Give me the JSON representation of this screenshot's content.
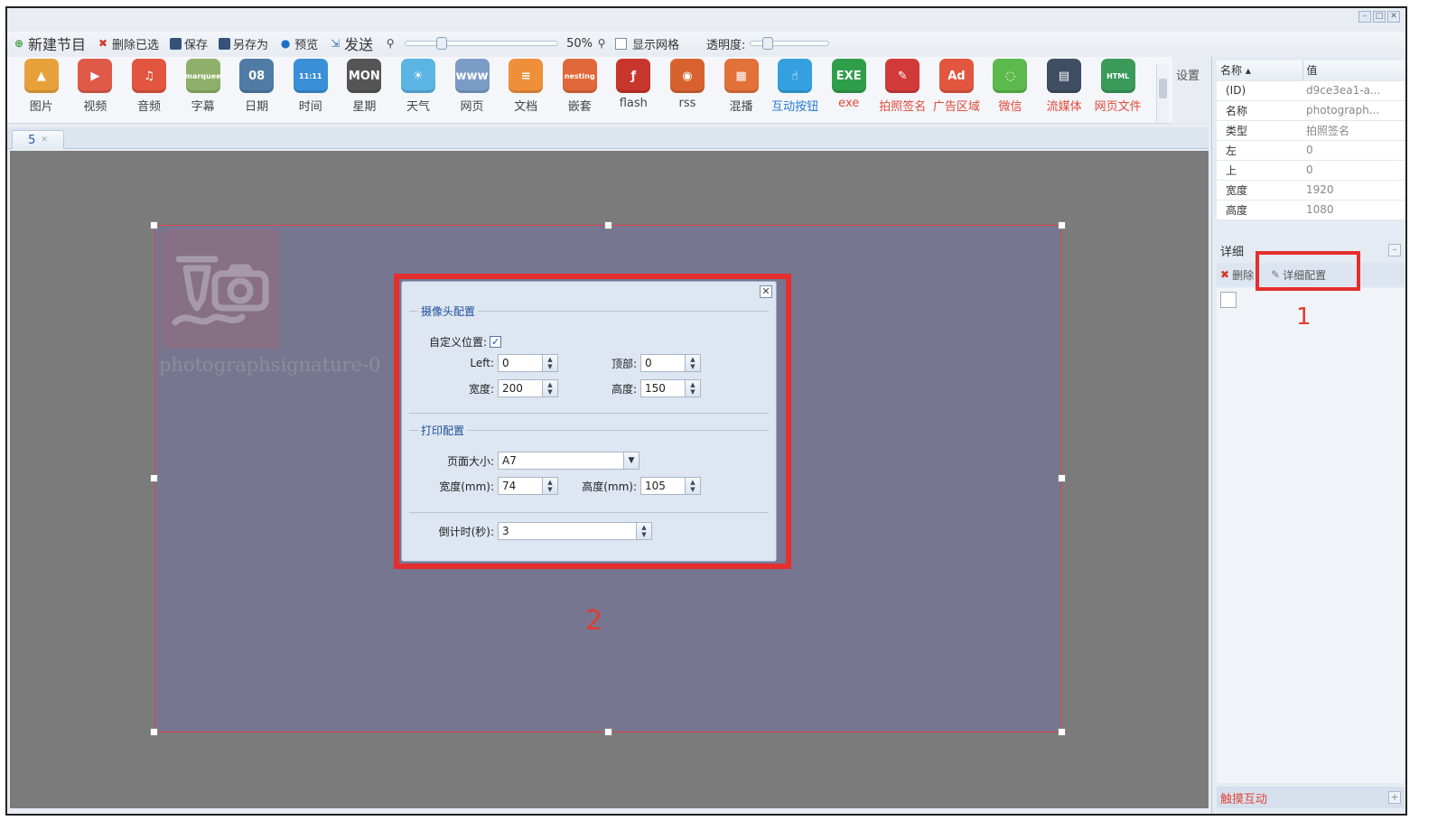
{
  "window_buttons": [
    "–",
    "□",
    "✕"
  ],
  "toolbar": {
    "new_program": "新建节目",
    "delete_selected": "删除已选",
    "save": "保存",
    "save_as": "另存为",
    "preview": "预览",
    "send": "发送",
    "zoom_label": "50%",
    "zoom_level": 0.2,
    "show_grid": "显示网格",
    "opacity_label": "透明度:",
    "opacity_level": 0.15
  },
  "ribbon": {
    "items": [
      {
        "label": "图片",
        "icon": "image-icon",
        "color": "#e8a13a",
        "glyph": "▲"
      },
      {
        "label": "视频",
        "icon": "video-icon",
        "color": "#e05a4a",
        "glyph": "▶"
      },
      {
        "label": "音频",
        "icon": "audio-icon",
        "color": "#e2563f",
        "glyph": "♫"
      },
      {
        "label": "字幕",
        "icon": "marquee-icon",
        "color": "#8fb06a",
        "glyph": "marquee"
      },
      {
        "label": "日期",
        "icon": "date-icon",
        "color": "#4f7ba6",
        "glyph": "08"
      },
      {
        "label": "时间",
        "icon": "time-icon",
        "color": "#3a8fd6",
        "glyph": "11:11"
      },
      {
        "label": "星期",
        "icon": "weekday-icon",
        "color": "#555555",
        "glyph": "MON"
      },
      {
        "label": "天气",
        "icon": "weather-icon",
        "color": "#5ab4e4",
        "glyph": "☀"
      },
      {
        "label": "网页",
        "icon": "webpage-icon",
        "color": "#7a9cc6",
        "glyph": "www"
      },
      {
        "label": "文档",
        "icon": "document-icon",
        "color": "#f08f3a",
        "glyph": "≡"
      },
      {
        "label": "嵌套",
        "icon": "nesting-icon",
        "color": "#e0683a",
        "glyph": "nesting"
      },
      {
        "label": "flash",
        "icon": "flash-icon",
        "color": "#c8352c",
        "glyph": "ƒ"
      },
      {
        "label": "rss",
        "icon": "rss-icon",
        "color": "#d8622f",
        "glyph": "◉"
      },
      {
        "label": "混播",
        "icon": "mixed-play-icon",
        "color": "#e2713a",
        "glyph": "▦"
      },
      {
        "label": "互动按钮",
        "icon": "interactive-button-icon",
        "color": "#35a0e0",
        "glyph": "☝",
        "style": "blue"
      },
      {
        "label": "exe",
        "icon": "exe-icon",
        "color": "#2e9e4a",
        "glyph": "EXE",
        "style": "red"
      },
      {
        "label": "拍照签名",
        "icon": "photo-signature-icon",
        "color": "#d23a3a",
        "glyph": "✎",
        "style": "red"
      },
      {
        "label": "广告区域",
        "icon": "ad-area-icon",
        "color": "#e2563f",
        "glyph": "Ad",
        "style": "red"
      },
      {
        "label": "微信",
        "icon": "wechat-icon",
        "color": "#5cb94b",
        "glyph": "◌",
        "style": "red"
      },
      {
        "label": "流媒体",
        "icon": "streaming-icon",
        "color": "#3f4e63",
        "glyph": "▤",
        "style": "red"
      },
      {
        "label": "网页文件",
        "icon": "html-file-icon",
        "color": "#3a9a5a",
        "glyph": "HTML",
        "style": "red"
      }
    ],
    "settings_label": "设置"
  },
  "tabs": [
    {
      "label": "5"
    }
  ],
  "canvas": {
    "widget_label": "photographsignature-0",
    "callout_2": "2"
  },
  "dialog": {
    "camera_legend": "摄像头配置",
    "custom_position_label": "自定义位置:",
    "custom_position_checked": true,
    "left_label": "Left:",
    "left_value": "0",
    "top_label": "顶部:",
    "top_value": "0",
    "cam_width_label": "宽度:",
    "cam_width_value": "200",
    "cam_height_label": "高度:",
    "cam_height_value": "150",
    "print_legend": "打印配置",
    "page_size_label": "页面大小:",
    "page_size_value": "A7",
    "width_mm_label": "宽度(mm):",
    "width_mm_value": "74",
    "height_mm_label": "高度(mm):",
    "height_mm_value": "105",
    "countdown_label": "倒计时(秒):",
    "countdown_value": "3"
  },
  "properties": {
    "header_name": "名称 ▴",
    "header_value": "值",
    "rows": [
      {
        "key": "(ID)",
        "value": "d9ce3ea1-a..."
      },
      {
        "key": "名称",
        "value": "photograph..."
      },
      {
        "key": "类型",
        "value": "拍照签名"
      },
      {
        "key": "左",
        "value": "0"
      },
      {
        "key": "上",
        "value": "0"
      },
      {
        "key": "宽度",
        "value": "1920"
      },
      {
        "key": "高度",
        "value": "1080"
      }
    ]
  },
  "detail": {
    "title": "详细",
    "delete_label": "删除",
    "config_label": "详细配置",
    "callout_1": "1"
  },
  "touch_interact": "触摸互动",
  "colors": {
    "highlight": "#e52e2e",
    "canvas_bg": "#7b7b7b",
    "stage_bg": "#767690"
  }
}
